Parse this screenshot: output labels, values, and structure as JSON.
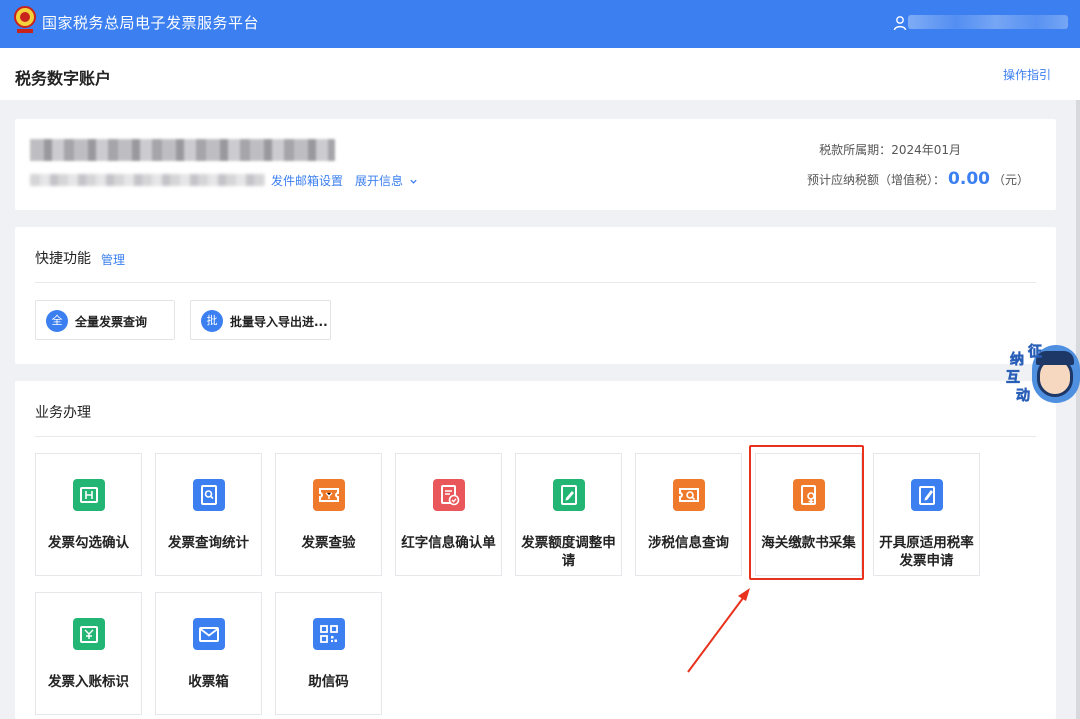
{
  "header": {
    "app_title": "国家税务总局电子发票服务平台",
    "brand_color": "#3b7ff0",
    "emblem_icon": "tax-emblem-icon",
    "user_icon": "user-icon"
  },
  "subheader": {
    "page_title": "税务数字账户",
    "guide_link": "操作指引"
  },
  "account": {
    "email_settings_link": "发件邮箱设置",
    "expand_info_link": "展开信息",
    "tax_period_label": "税款所属期：",
    "tax_period_value": "2024年01月",
    "estimated_tax_label": "预计应纳税额（增值税）：",
    "estimated_tax_value": "0.00",
    "estimated_tax_unit": "（元）"
  },
  "quick_functions": {
    "title": "快捷功能",
    "manage_link": "管理",
    "items": [
      {
        "badge": "全",
        "label": "全量发票查询"
      },
      {
        "badge": "批",
        "label": "批量导入导出进..."
      }
    ]
  },
  "business": {
    "title": "业务办理",
    "tiles": [
      {
        "label": "发票勾选确认",
        "icon": "invoice-check-icon",
        "color": "#22b573"
      },
      {
        "label": "发票查询统计",
        "icon": "invoice-search-icon",
        "color": "#3b7ff0"
      },
      {
        "label": "发票查验",
        "icon": "invoice-verify-icon",
        "color": "#f07a2b"
      },
      {
        "label": "红字信息确认单",
        "icon": "red-letter-confirm-icon",
        "color": "#e9575b"
      },
      {
        "label": "发票额度调整申请",
        "icon": "quota-adjust-icon",
        "color": "#22b573"
      },
      {
        "label": "涉税信息查询",
        "icon": "tax-info-search-icon",
        "color": "#f07a2b"
      },
      {
        "label": "海关缴款书采集",
        "icon": "customs-payment-icon",
        "color": "#f07a2b"
      },
      {
        "label": "开具原适用税率发票申请",
        "icon": "original-rate-invoice-icon",
        "color": "#3b7ff0"
      },
      {
        "label": "发票入账标识",
        "icon": "invoice-accounting-icon",
        "color": "#22b573"
      },
      {
        "label": "收票箱",
        "icon": "inbox-mail-icon",
        "color": "#3b7ff0"
      },
      {
        "label": "助信码",
        "icon": "qr-code-icon",
        "color": "#3b7ff0"
      }
    ]
  },
  "mascot": {
    "chars": [
      "征",
      "纳",
      "互",
      "动"
    ]
  },
  "annotation_color": "#e8321d"
}
